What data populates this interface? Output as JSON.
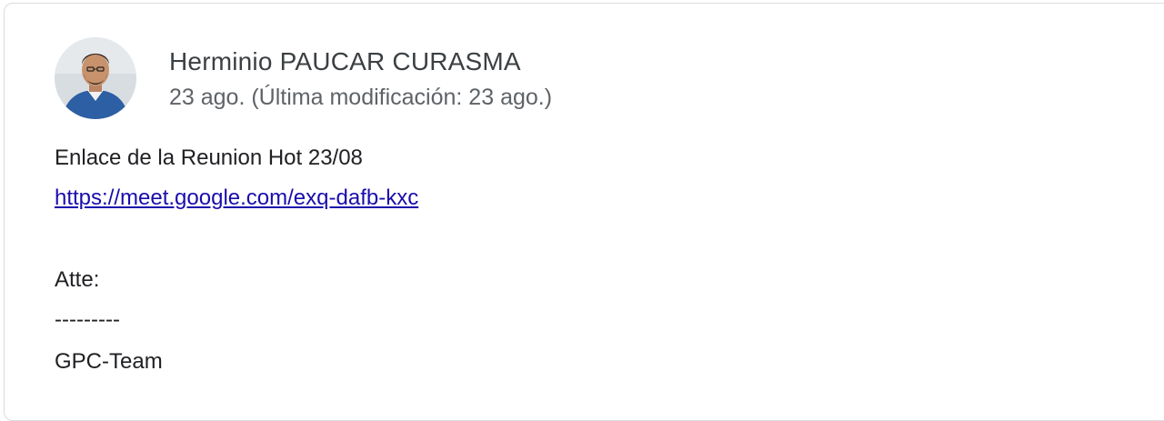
{
  "post": {
    "author": "Herminio PAUCAR CURASMA",
    "date": "23 ago. (Última modificación: 23 ago.)",
    "body": {
      "line1": "Enlace de la Reunion Hot 23/08",
      "link": "https://meet.google.com/exq-dafb-kxc",
      "signature_label": "Atte:",
      "separator": "---------",
      "team": "GPC-Team"
    }
  },
  "colors": {
    "link": "#1a0dab",
    "author": "#3c4043",
    "date": "#5f6368",
    "text": "#202124",
    "card_border": "#dadce0"
  },
  "icons": {
    "avatar": "user-profile-photo"
  }
}
